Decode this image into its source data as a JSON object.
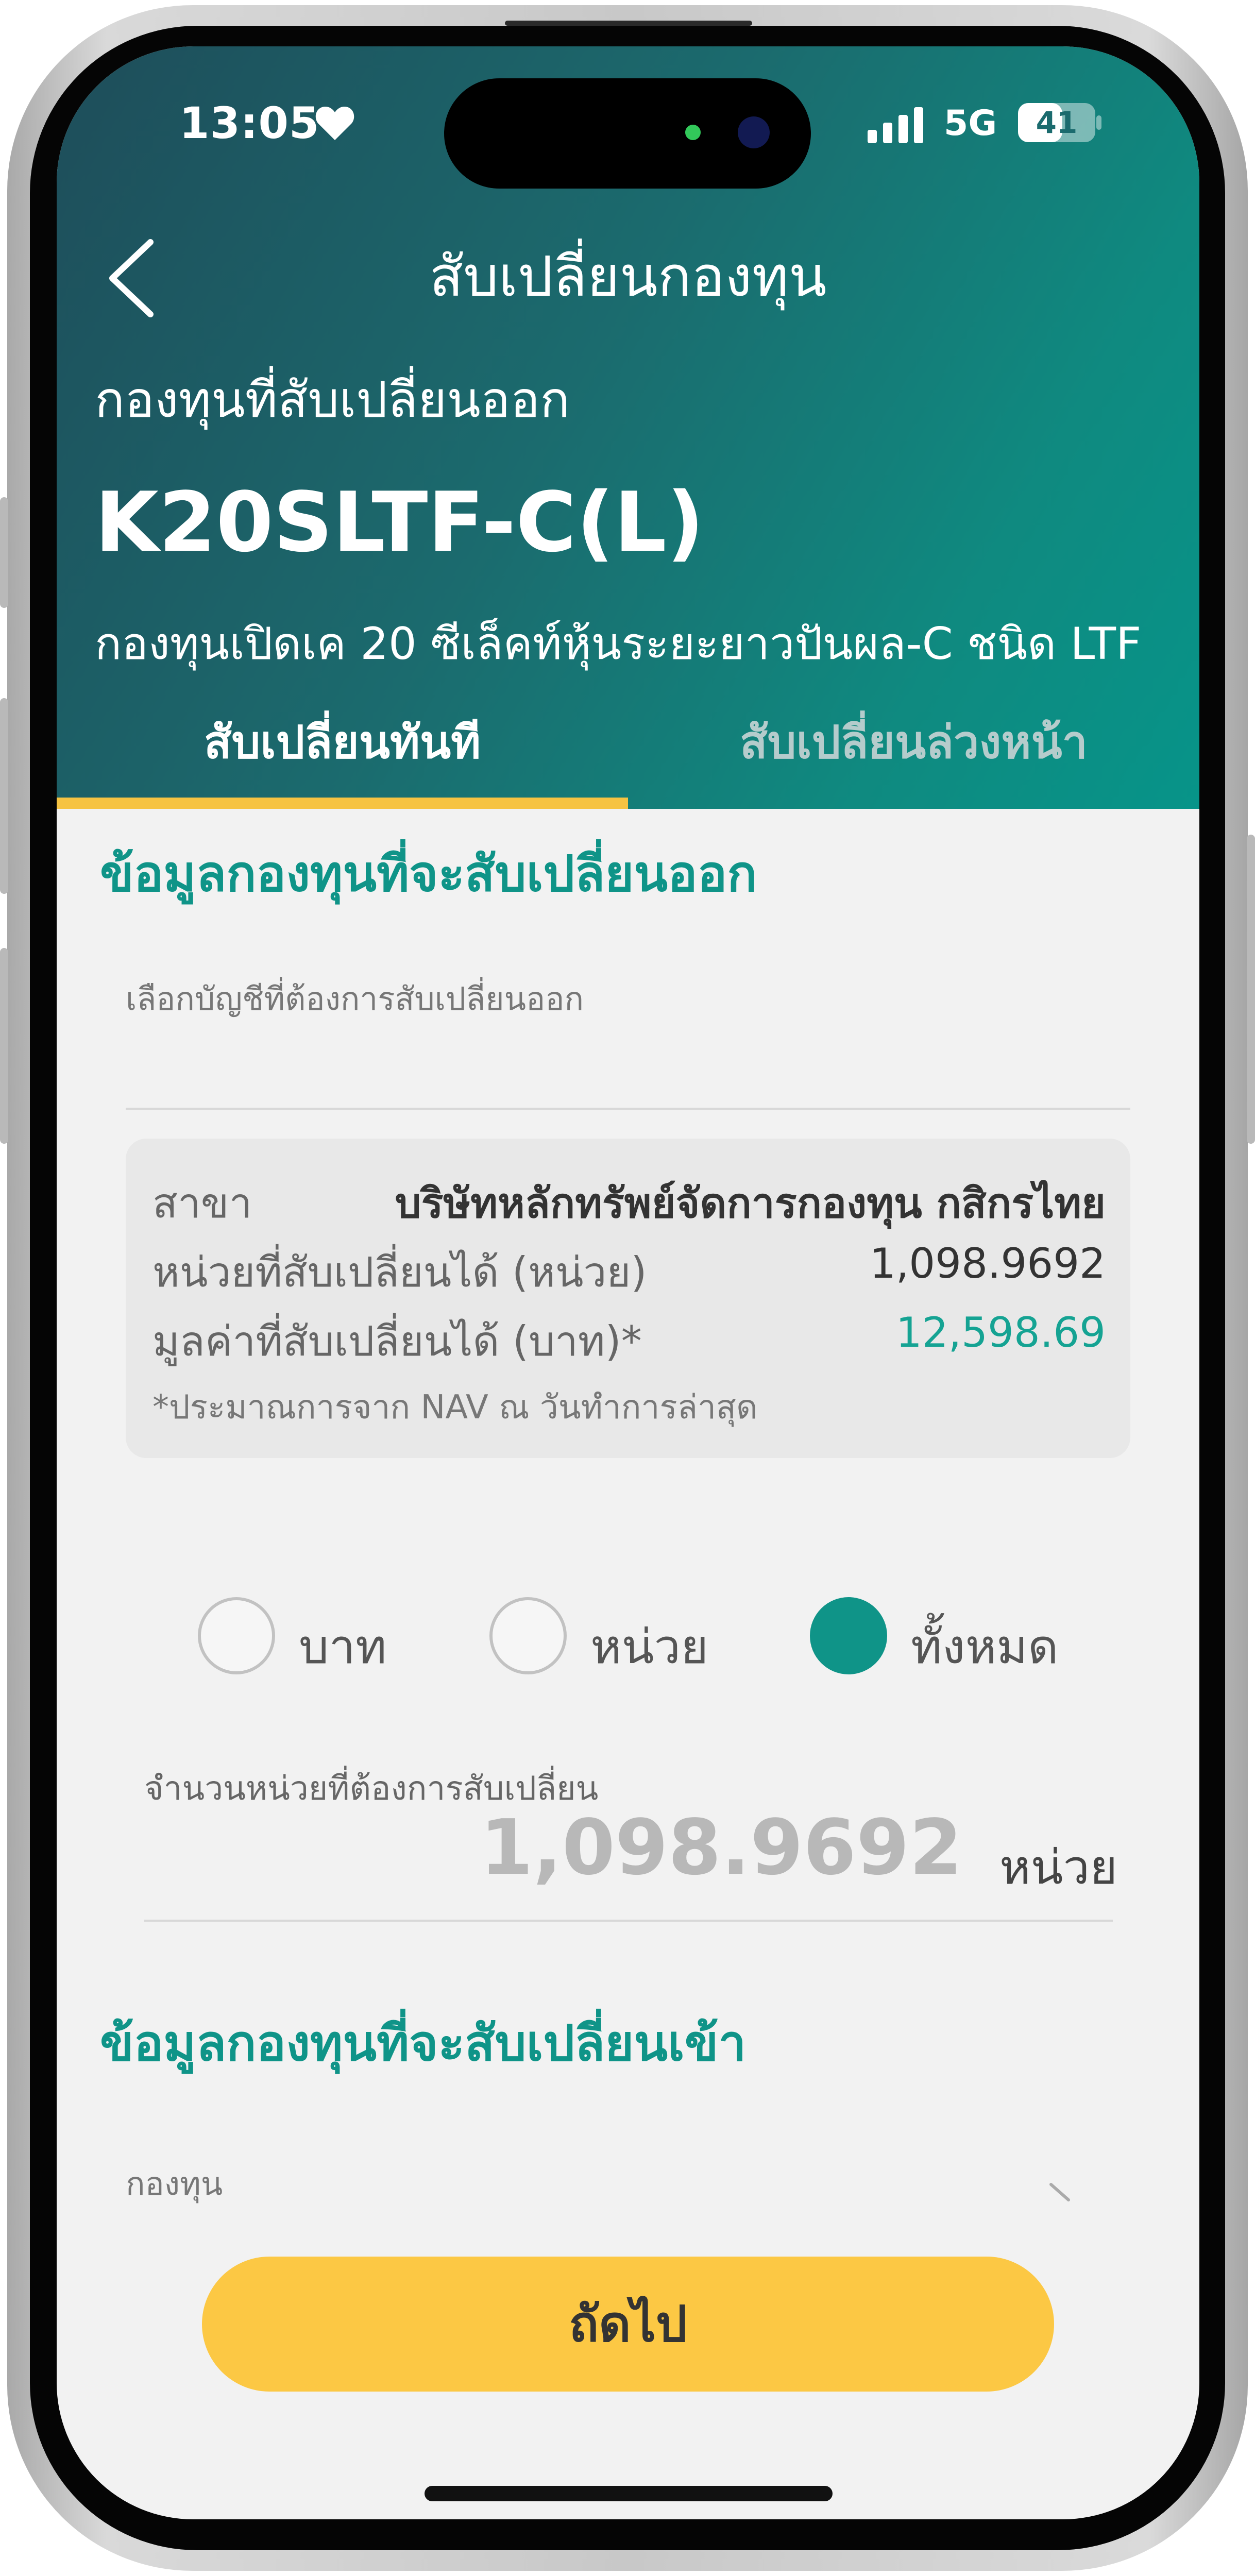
{
  "status_bar": {
    "time": "13:05",
    "network": "5G",
    "battery": "41",
    "icons": [
      "heart-icon",
      "signal-icon",
      "battery-icon"
    ]
  },
  "header": {
    "title": "สับเปลี่ยนกองทุน",
    "section_label": "กองทุนที่สับเปลี่ยนออก",
    "fund_code": "K20SLTF-C(L)",
    "fund_name": "กองทุนเปิดเค 20 ซีเล็คท์หุ้นระยะยาวปันผล-C ชนิด LTF",
    "tabs": [
      {
        "label": "สับเปลี่ยนทันที",
        "active": true
      },
      {
        "label": "สับเปลี่ยนล่วงหน้า",
        "active": false
      }
    ]
  },
  "switch_out": {
    "heading": "ข้อมูลกองทุนที่จะสับเปลี่ยนออก",
    "account_label": "เลือกบัญชีที่ต้องการสับเปลี่ยนออก",
    "info": {
      "branch_label": "สาขา",
      "branch_value": "บริษัทหลักทรัพย์จัดการกองทุน กสิกรไทย",
      "units_label": "หน่วยที่สับเปลี่ยนได้ (หน่วย)",
      "units_value": "1,098.9692",
      "amount_label": "มูลค่าที่สับเปลี่ยนได้ (บาท)*",
      "amount_value": "12,598.69",
      "note": "*ประมาณการจาก NAV ณ วันทำการล่าสุด"
    },
    "options": [
      {
        "label": "บาท",
        "selected": false
      },
      {
        "label": "หน่วย",
        "selected": false
      },
      {
        "label": "ทั้งหมด",
        "selected": true
      }
    ],
    "amount_field_label": "จำนวนหน่วยที่ต้องการสับเปลี่ยน",
    "amount_value": "1,098.9692",
    "amount_unit": "หน่วย"
  },
  "switch_in": {
    "heading": "ข้อมูลกองทุนที่จะสับเปลี่ยนเข้า",
    "fund_label": "กองทุน"
  },
  "next_button": "ถัดไป",
  "colors": {
    "accent_teal": "#0f9488",
    "button_yellow": "#fcc844",
    "tab_indicator": "#f6c342",
    "value_green": "#15a393"
  }
}
